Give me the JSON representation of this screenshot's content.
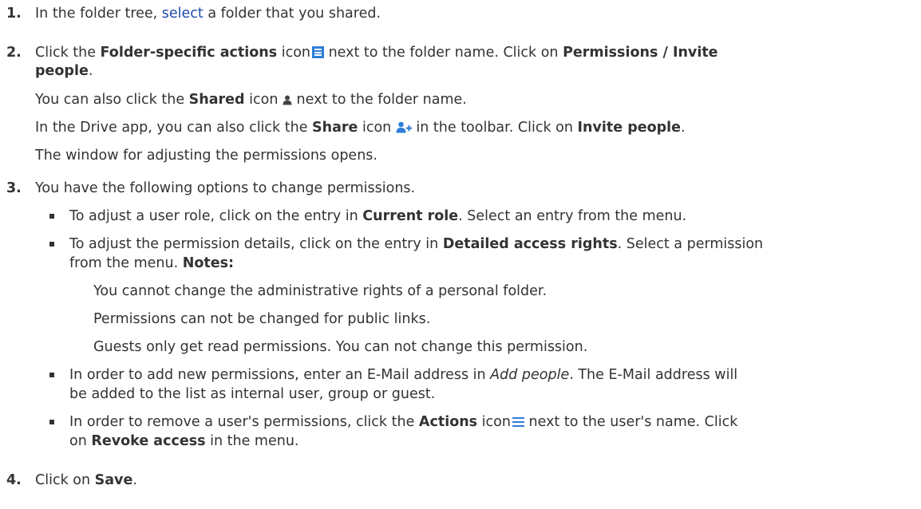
{
  "steps": {
    "s1": {
      "num": "1.",
      "before": "In the folder tree, ",
      "link": "select",
      "after": " a folder that you shared."
    },
    "s2": {
      "num": "2.",
      "l1a": "Click the ",
      "l1b": "Folder-specific actions",
      "l1c": " icon",
      "l1d": " next to the folder name. Click on ",
      "l1e": "Permissions / Invite",
      "l2a": "people",
      "l2b": ".",
      "l3a": "You can also click the ",
      "l3b": "Shared",
      "l3c": " icon ",
      "l3d": " next to the folder name.",
      "l4a": "In the Drive app, you can also click the ",
      "l4b": "Share",
      "l4c": " icon ",
      "l4d": " in the toolbar. Click on ",
      "l4e": "Invite people",
      "l4f": ".",
      "l5": "The window for adjusting the permissions opens."
    },
    "s3": {
      "num": "3.",
      "intro": "You have the following options to change permissions.",
      "b1a": "To adjust a user role, click on the entry in ",
      "b1b": "Current role",
      "b1c": ". Select an entry from the menu.",
      "b2a": "To adjust the permission details, click on the entry in ",
      "b2b": "Detailed access rights",
      "b2c": ". Select a permission",
      "b2d": "from the menu. ",
      "b2e": "Notes:",
      "n1": "You cannot change the administrative rights of a personal folder.",
      "n2": "Permissions can not be changed for public links.",
      "n3": "Guests only get read permissions. You can not change this permission.",
      "b3a": "In order to add new permissions, enter an E-Mail address in ",
      "b3b": "Add people",
      "b3c": ". The E-Mail address will",
      "b3d": "be added to the list as internal user, group or guest.",
      "b4a": "In order to remove a user's permissions, click the ",
      "b4b": "Actions",
      "b4c": " icon",
      "b4d": " next to the user's name. Click",
      "b4e": "on ",
      "b4f": "Revoke access",
      "b4g": " in the menu."
    },
    "s4": {
      "num": "4.",
      "a": "Click on ",
      "b": "Save",
      "c": "."
    }
  },
  "icons": {
    "folder_actions": "menu-box-icon",
    "shared": "person-icon",
    "share": "add-person-icon",
    "actions": "hamburger-icon"
  },
  "colors": {
    "text": "#333333",
    "link": "#1f4aa8",
    "icon": "#2f7ed8"
  }
}
